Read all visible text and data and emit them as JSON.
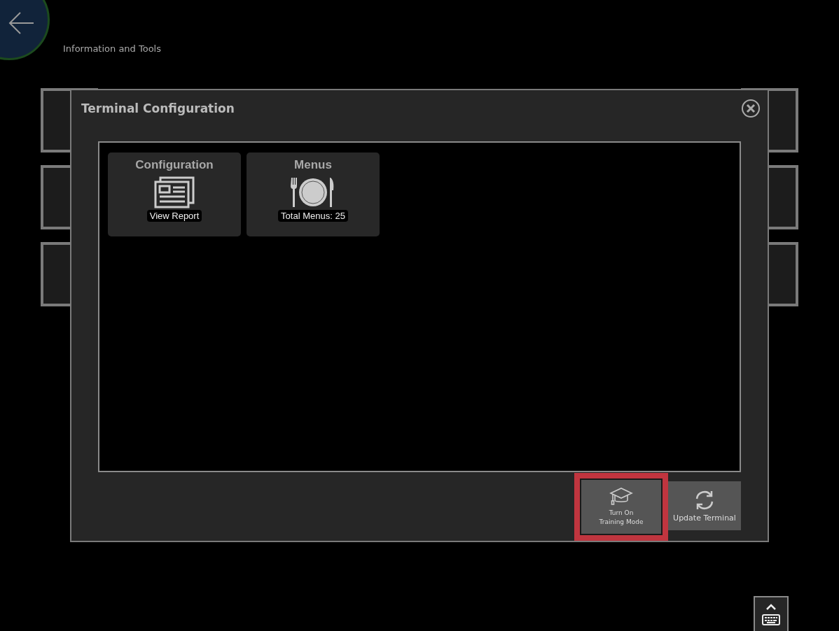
{
  "header": {
    "title": "Information and Tools"
  },
  "dialog": {
    "title": "Terminal Configuration",
    "tiles": [
      {
        "kind": "report",
        "title": "Configuration",
        "badge": "View Report"
      },
      {
        "kind": "menus",
        "title": "Menus",
        "badge": "Total Menus: 25"
      }
    ],
    "actions": [
      {
        "kind": "training",
        "label_lines": [
          "Turn On",
          "Training Mode"
        ],
        "highlighted": true
      },
      {
        "kind": "update",
        "label_lines": [
          "Update Terminal"
        ],
        "highlighted": false
      }
    ]
  }
}
